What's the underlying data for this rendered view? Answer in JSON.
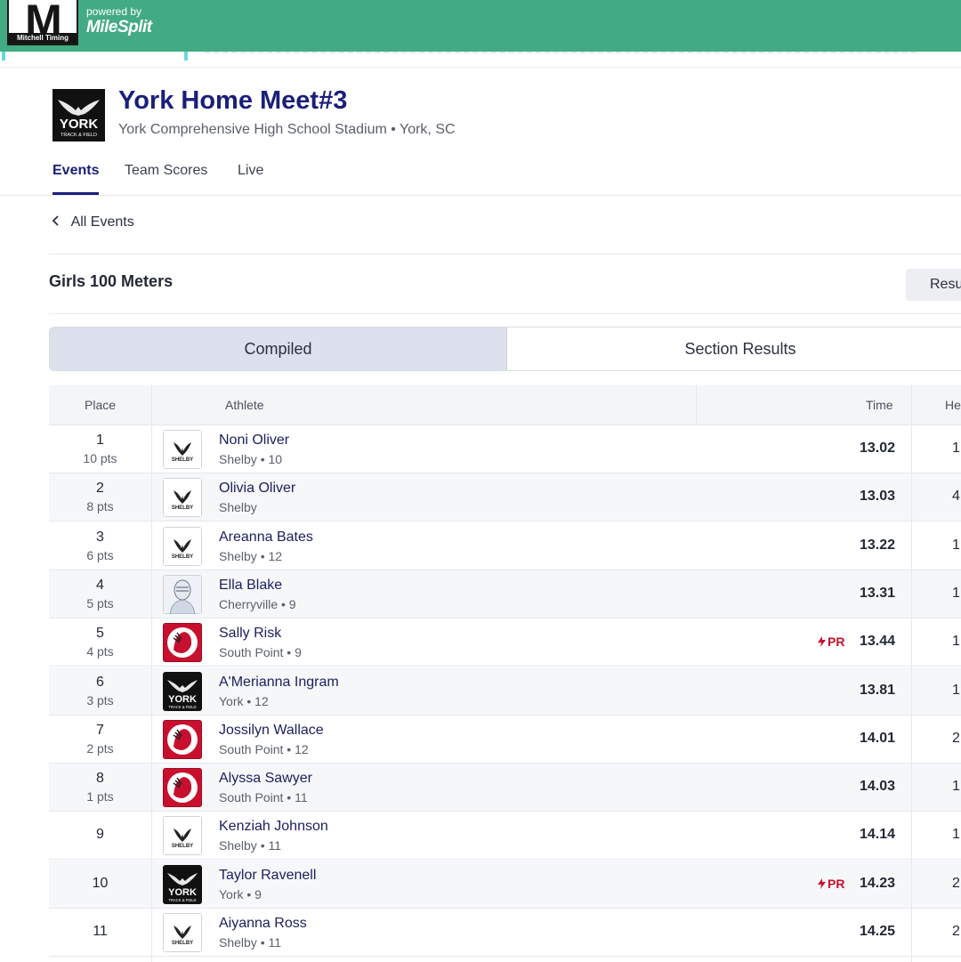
{
  "header": {
    "logo_letter": "M",
    "logo_caption": "Mitchell Timing",
    "powered_by": "powered by",
    "brand": "MileSplit"
  },
  "meet": {
    "title": "York Home Meet#3",
    "location": "York Comprehensive High School Stadium • York, SC",
    "tabs": [
      {
        "label": "Events",
        "active": true
      },
      {
        "label": "Team Scores",
        "active": false
      },
      {
        "label": "Live",
        "active": false
      }
    ],
    "back_label": "All Events"
  },
  "event": {
    "name": "Girls 100 Meters",
    "results_button": "Resu",
    "segments": {
      "compiled": "Compiled",
      "section": "Section Results"
    }
  },
  "table": {
    "headers": {
      "place": "Place",
      "athlete": "Athlete",
      "time": "Time",
      "heat": "He"
    },
    "rows": [
      {
        "place": "1",
        "pts": "10 pts",
        "name": "Noni Oliver",
        "team": "Shelby • 10",
        "logo": "shelby",
        "pr": "",
        "time": "13.02",
        "heat": "1"
      },
      {
        "place": "2",
        "pts": "8 pts",
        "name": "Olivia Oliver",
        "team": "Shelby",
        "logo": "shelby",
        "pr": "",
        "time": "13.03",
        "heat": "4"
      },
      {
        "place": "3",
        "pts": "6 pts",
        "name": "Areanna Bates",
        "team": "Shelby • 12",
        "logo": "shelby",
        "pr": "",
        "time": "13.22",
        "heat": "1"
      },
      {
        "place": "4",
        "pts": "5 pts",
        "name": "Ella Blake",
        "team": "Cherryville • 9",
        "logo": "cherryville",
        "pr": "",
        "time": "13.31",
        "heat": "1"
      },
      {
        "place": "5",
        "pts": "4 pts",
        "name": "Sally Risk",
        "team": "South Point • 9",
        "logo": "southpoint",
        "pr": "PR",
        "time": "13.44",
        "heat": "1"
      },
      {
        "place": "6",
        "pts": "3 pts",
        "name": "A'Merianna Ingram",
        "team": "York • 12",
        "logo": "york",
        "pr": "",
        "time": "13.81",
        "heat": "1"
      },
      {
        "place": "7",
        "pts": "2 pts",
        "name": "Jossilyn Wallace",
        "team": "South Point • 12",
        "logo": "southpoint",
        "pr": "",
        "time": "14.01",
        "heat": "2"
      },
      {
        "place": "8",
        "pts": "1 pts",
        "name": "Alyssa Sawyer",
        "team": "South Point • 11",
        "logo": "southpoint",
        "pr": "",
        "time": "14.03",
        "heat": "1"
      },
      {
        "place": "9",
        "pts": "",
        "name": "Kenziah Johnson",
        "team": "Shelby • 11",
        "logo": "shelby",
        "pr": "",
        "time": "14.14",
        "heat": "1"
      },
      {
        "place": "10",
        "pts": "",
        "name": "Taylor Ravenell",
        "team": "York • 9",
        "logo": "york",
        "pr": "PR",
        "time": "14.23",
        "heat": "2"
      },
      {
        "place": "11",
        "pts": "",
        "name": "Aiyanna Ross",
        "team": "Shelby • 11",
        "logo": "shelby",
        "pr": "",
        "time": "14.25",
        "heat": "2"
      }
    ]
  },
  "colors": {
    "header_green": "#43ab83",
    "title_navy": "#1a1f7a",
    "pr_red": "#c8102e"
  }
}
